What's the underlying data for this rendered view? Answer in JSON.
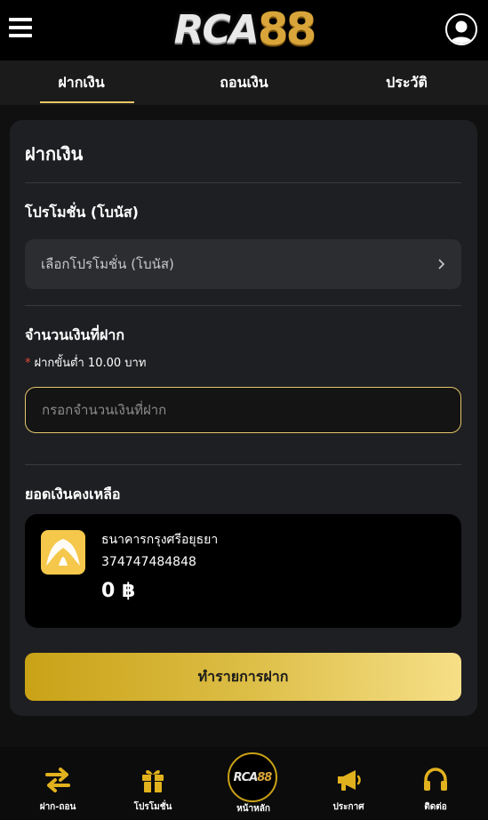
{
  "header": {
    "logo_letters": "RCA",
    "logo_number": "88",
    "menu_icon": "hamburger-menu-icon",
    "profile_icon": "user-avatar-icon"
  },
  "tabs": [
    {
      "label": "ฝากเงิน",
      "active": true
    },
    {
      "label": "ถอนเงิน",
      "active": false
    },
    {
      "label": "ประวัติ",
      "active": false
    }
  ],
  "deposit": {
    "title": "ฝากเงิน",
    "promo_label": "โปรโมชั่น (โบนัส)",
    "promo_placeholder": "เลือกโปรโมชั่น (โบนัส)",
    "amount_label": "จำนวนเงินที่ฝาก",
    "min_hint_star": "*",
    "min_hint": "ฝากขั้นต่ำ 10.00 บาท",
    "amount_placeholder": "กรอกจำนวนเงินที่ฝาก",
    "balance_label": "ยอดเงินคงเหลือ",
    "bank_name": "ธนาคารกรุงศรีอยุธยา",
    "account_number": "374747484848",
    "balance": "0 ฿",
    "submit_label": "ทำรายการฝาก"
  },
  "bottom_nav": [
    {
      "label": "ฝาก-ถอน",
      "icon": "transfer-arrows-icon"
    },
    {
      "label": "โปรโมชั่น",
      "icon": "gift-icon"
    },
    {
      "label": "หน้าหลัก",
      "icon": "home-logo-icon"
    },
    {
      "label": "ประกาศ",
      "icon": "megaphone-icon"
    },
    {
      "label": "ติดต่อ",
      "icon": "headset-icon"
    }
  ],
  "home_logo": {
    "letters": "RCA",
    "number": "88"
  },
  "colors": {
    "accent_gold": "#e9c766",
    "icon_gold": "#e2b21e",
    "button_gradient_start": "#c9a216",
    "button_gradient_end": "#f6df87",
    "card_bg": "#1e1f22",
    "page_bg": "#101010"
  }
}
